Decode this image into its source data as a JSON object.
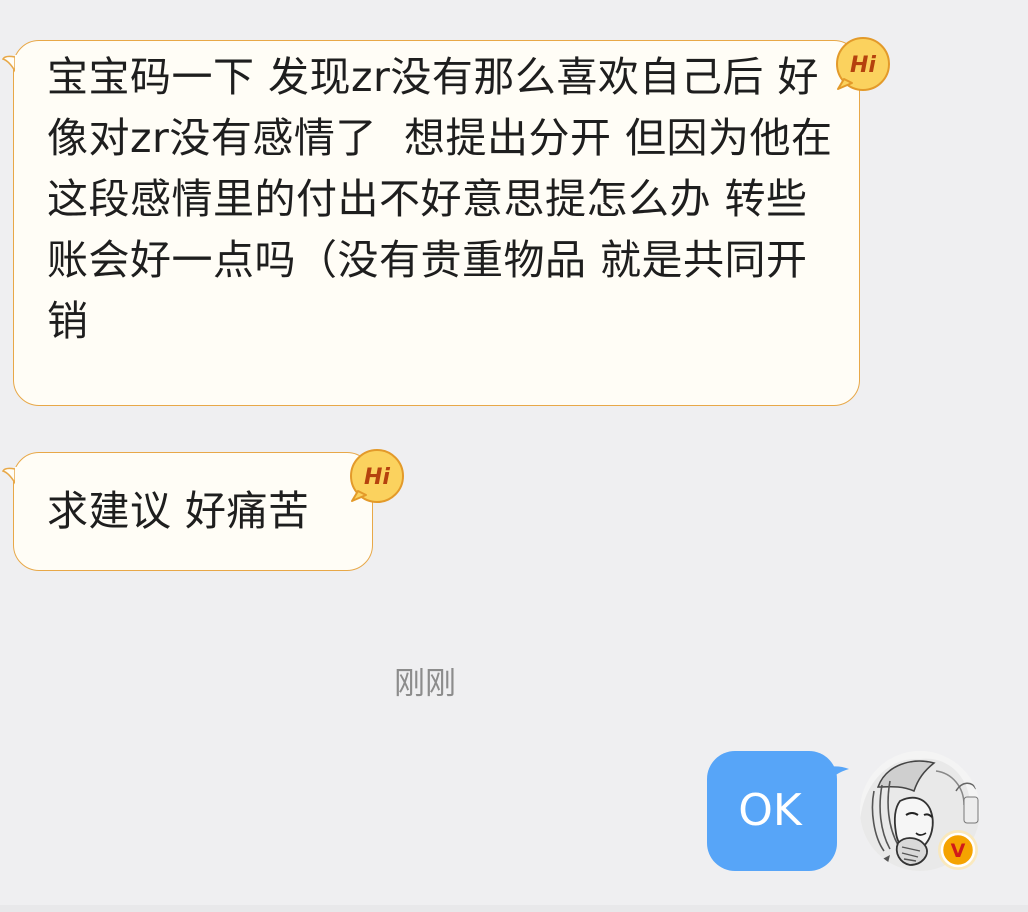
{
  "messages": [
    {
      "direction": "incoming",
      "badge_text": "Hi",
      "text": "宝宝码一下 发现zr没有那么喜欢自己后 好像对zr没有感情了  想提出分开 但因为他在这段感情里的付出不好意思提怎么办 转些账会好一点吗（没有贵重物品 就是共同开销"
    },
    {
      "direction": "incoming",
      "badge_text": "Hi",
      "text": "求建议 好痛苦"
    },
    {
      "direction": "outgoing",
      "text": "OK"
    }
  ],
  "timestamp": "刚刚",
  "avatar": {
    "icon": "user-avatar-manga-portrait",
    "badge_icon": "verified-v-icon",
    "badge_text": "V",
    "badge_color": "#f5a300"
  },
  "colors": {
    "background": "#efeff1",
    "incoming_bubble": "#fffdf6",
    "incoming_border": "#e8a848",
    "outgoing_bubble": "#57a5f8",
    "hi_badge": "#fbd25e",
    "timestamp_text": "#8c8c8c"
  }
}
